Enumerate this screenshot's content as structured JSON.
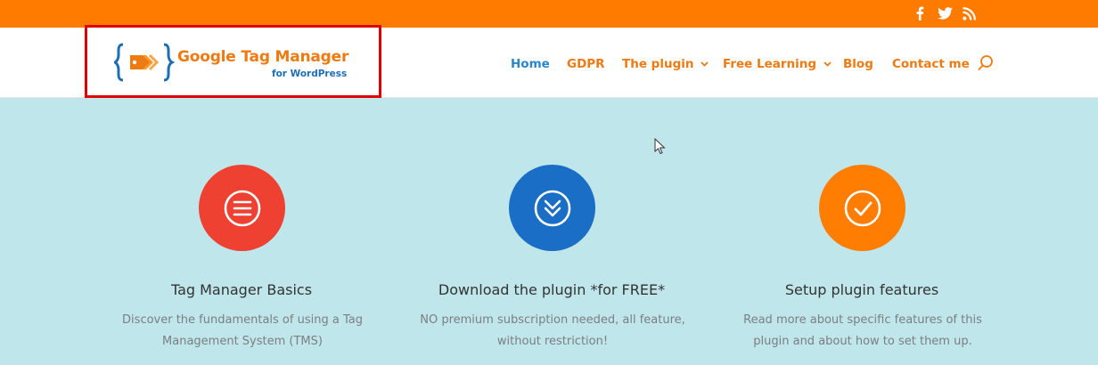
{
  "topbar": {
    "social": [
      {
        "name": "facebook-icon"
      },
      {
        "name": "twitter-icon"
      },
      {
        "name": "rss-icon"
      }
    ]
  },
  "logo": {
    "title": "Google Tag Manager",
    "subtitle": "for WordPress",
    "highlight_color": "#e00000"
  },
  "nav": {
    "items": [
      {
        "label": "Home",
        "active": true
      },
      {
        "label": "GDPR"
      },
      {
        "label": "The plugin",
        "dropdown": true
      },
      {
        "label": "Free Learning",
        "dropdown": true
      },
      {
        "label": "Blog"
      },
      {
        "label": "Contact me"
      }
    ],
    "search_icon": "search-icon"
  },
  "features": [
    {
      "icon": "menu-lines-icon",
      "color": "#ee4132",
      "title": "Tag Manager Basics",
      "text": "Discover the fundamentals of using a Tag Management System (TMS)"
    },
    {
      "icon": "double-chevron-down-icon",
      "color": "#1a6ec6",
      "title": "Download the plugin *for FREE*",
      "text": "NO premium subscription needed, all feature, without restriction!"
    },
    {
      "icon": "checkmark-icon",
      "color": "#ff7d00",
      "title": "Setup plugin features",
      "text": "Read more about specific features of this plugin and about how to set them up."
    }
  ],
  "colors": {
    "topbar": "#ff7b00",
    "accent_orange": "#ee7a12",
    "accent_blue": "#2a86c8",
    "page_background": "#bfe6ea"
  }
}
